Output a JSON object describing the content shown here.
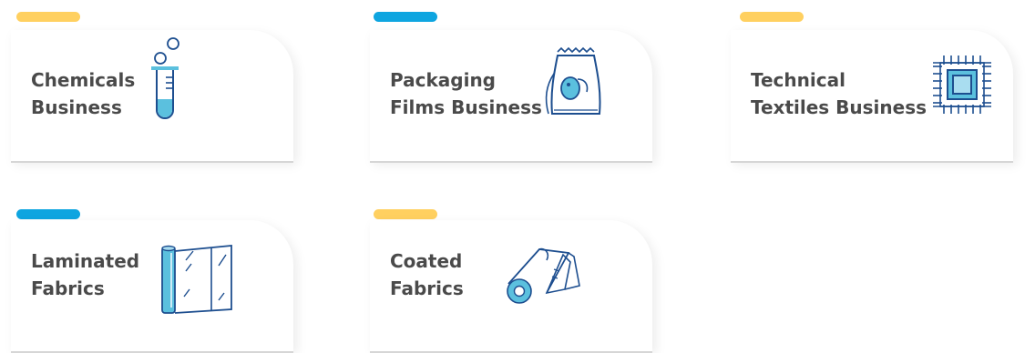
{
  "cards": [
    {
      "pill_color": "#FFD060",
      "line1": "Chemicals",
      "line2": "Business"
    },
    {
      "pill_color": "#0EA5E0",
      "line1": "Packaging",
      "line2": "Films Business"
    },
    {
      "pill_color": "#FFD060",
      "line1": "Technical",
      "line2": "Textiles Business"
    },
    {
      "pill_color": "#0EA5E0",
      "line1": "Laminated",
      "line2": "Fabrics"
    },
    {
      "pill_color": "#FFD060",
      "line1": "Coated",
      "line2": "Fabrics"
    }
  ],
  "icons": {
    "card0": "test-tube-icon",
    "card1": "packaging-bag-icon",
    "card2": "fabric-chip-icon",
    "card3": "laminated-sheet-icon",
    "card4": "fabric-roll-icon"
  },
  "colors": {
    "icon_stroke": "#1D4E8F",
    "icon_fill": "#5BC0DE",
    "title_text": "#4A4A4A"
  }
}
